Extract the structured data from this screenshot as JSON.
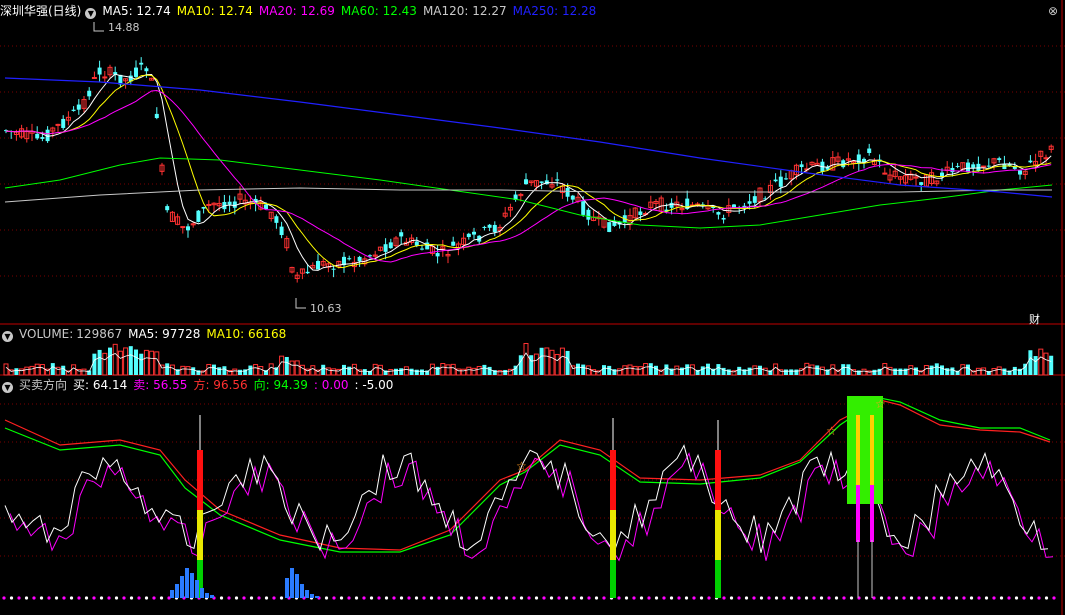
{
  "main": {
    "title": "深圳华强(日线)",
    "ma": [
      {
        "label": "MA5: 12.74",
        "color": "#ffffff"
      },
      {
        "label": "MA10: 12.74",
        "color": "#ffff00"
      },
      {
        "label": "MA20: 12.69",
        "color": "#ff00ff"
      },
      {
        "label": "MA60: 12.43",
        "color": "#00ff00"
      },
      {
        "label": "MA120: 12.27",
        "color": "#c8c8c8"
      },
      {
        "label": "MA250: 12.28",
        "color": "#2020ff"
      }
    ],
    "high_label": "14.88",
    "low_label": "10.63",
    "badge": "财"
  },
  "volume": {
    "name": "VOLUME:",
    "value": "129867",
    "ma5": "MA5: 97728",
    "ma10": "MA10: 66168"
  },
  "indicator": {
    "name": "买卖方向",
    "items": [
      {
        "label": "买: 64.14",
        "color": "#ffffff"
      },
      {
        "label": "卖: 56.55",
        "color": "#ff00ff"
      },
      {
        "label": "方: 96.56",
        "color": "#ff3030"
      },
      {
        "label": "向: 94.39",
        "color": "#00ff00"
      },
      {
        "label": ": 0.00",
        "color": "#ff00ff"
      },
      {
        "label": ": -5.00",
        "color": "#ffffff"
      }
    ]
  },
  "colors": {
    "up": "#ff3232",
    "down": "#54ffff",
    "grid": "#7a0000",
    "divider": "#c00000"
  }
}
